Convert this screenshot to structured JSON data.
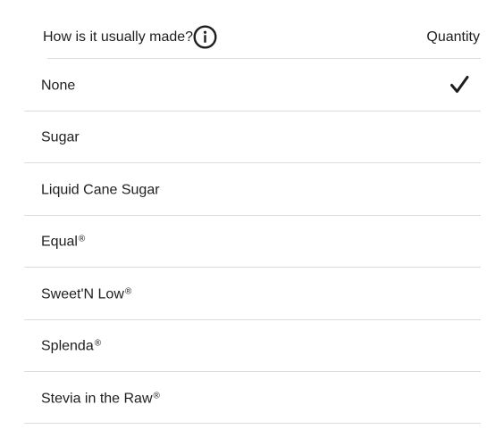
{
  "header": {
    "question": "How is it usually made?",
    "info_icon": "info-circle-icon",
    "quantity_label": "Quantity"
  },
  "options": [
    {
      "label": "None",
      "reg": "",
      "selected": true
    },
    {
      "label": "Sugar",
      "reg": "",
      "selected": false
    },
    {
      "label": "Liquid Cane Sugar",
      "reg": "",
      "selected": false
    },
    {
      "label": "Equal",
      "reg": "®",
      "selected": false
    },
    {
      "label": "Sweet'N Low",
      "reg": "®",
      "selected": false
    },
    {
      "label": "Splenda",
      "reg": "®",
      "selected": false
    },
    {
      "label": "Stevia in the Raw",
      "reg": "®",
      "selected": false
    }
  ],
  "selected_icon": "checkmark-icon",
  "colors": {
    "text": "#1e1e1e",
    "divider": "#dcdcdc",
    "background": "#ffffff"
  }
}
